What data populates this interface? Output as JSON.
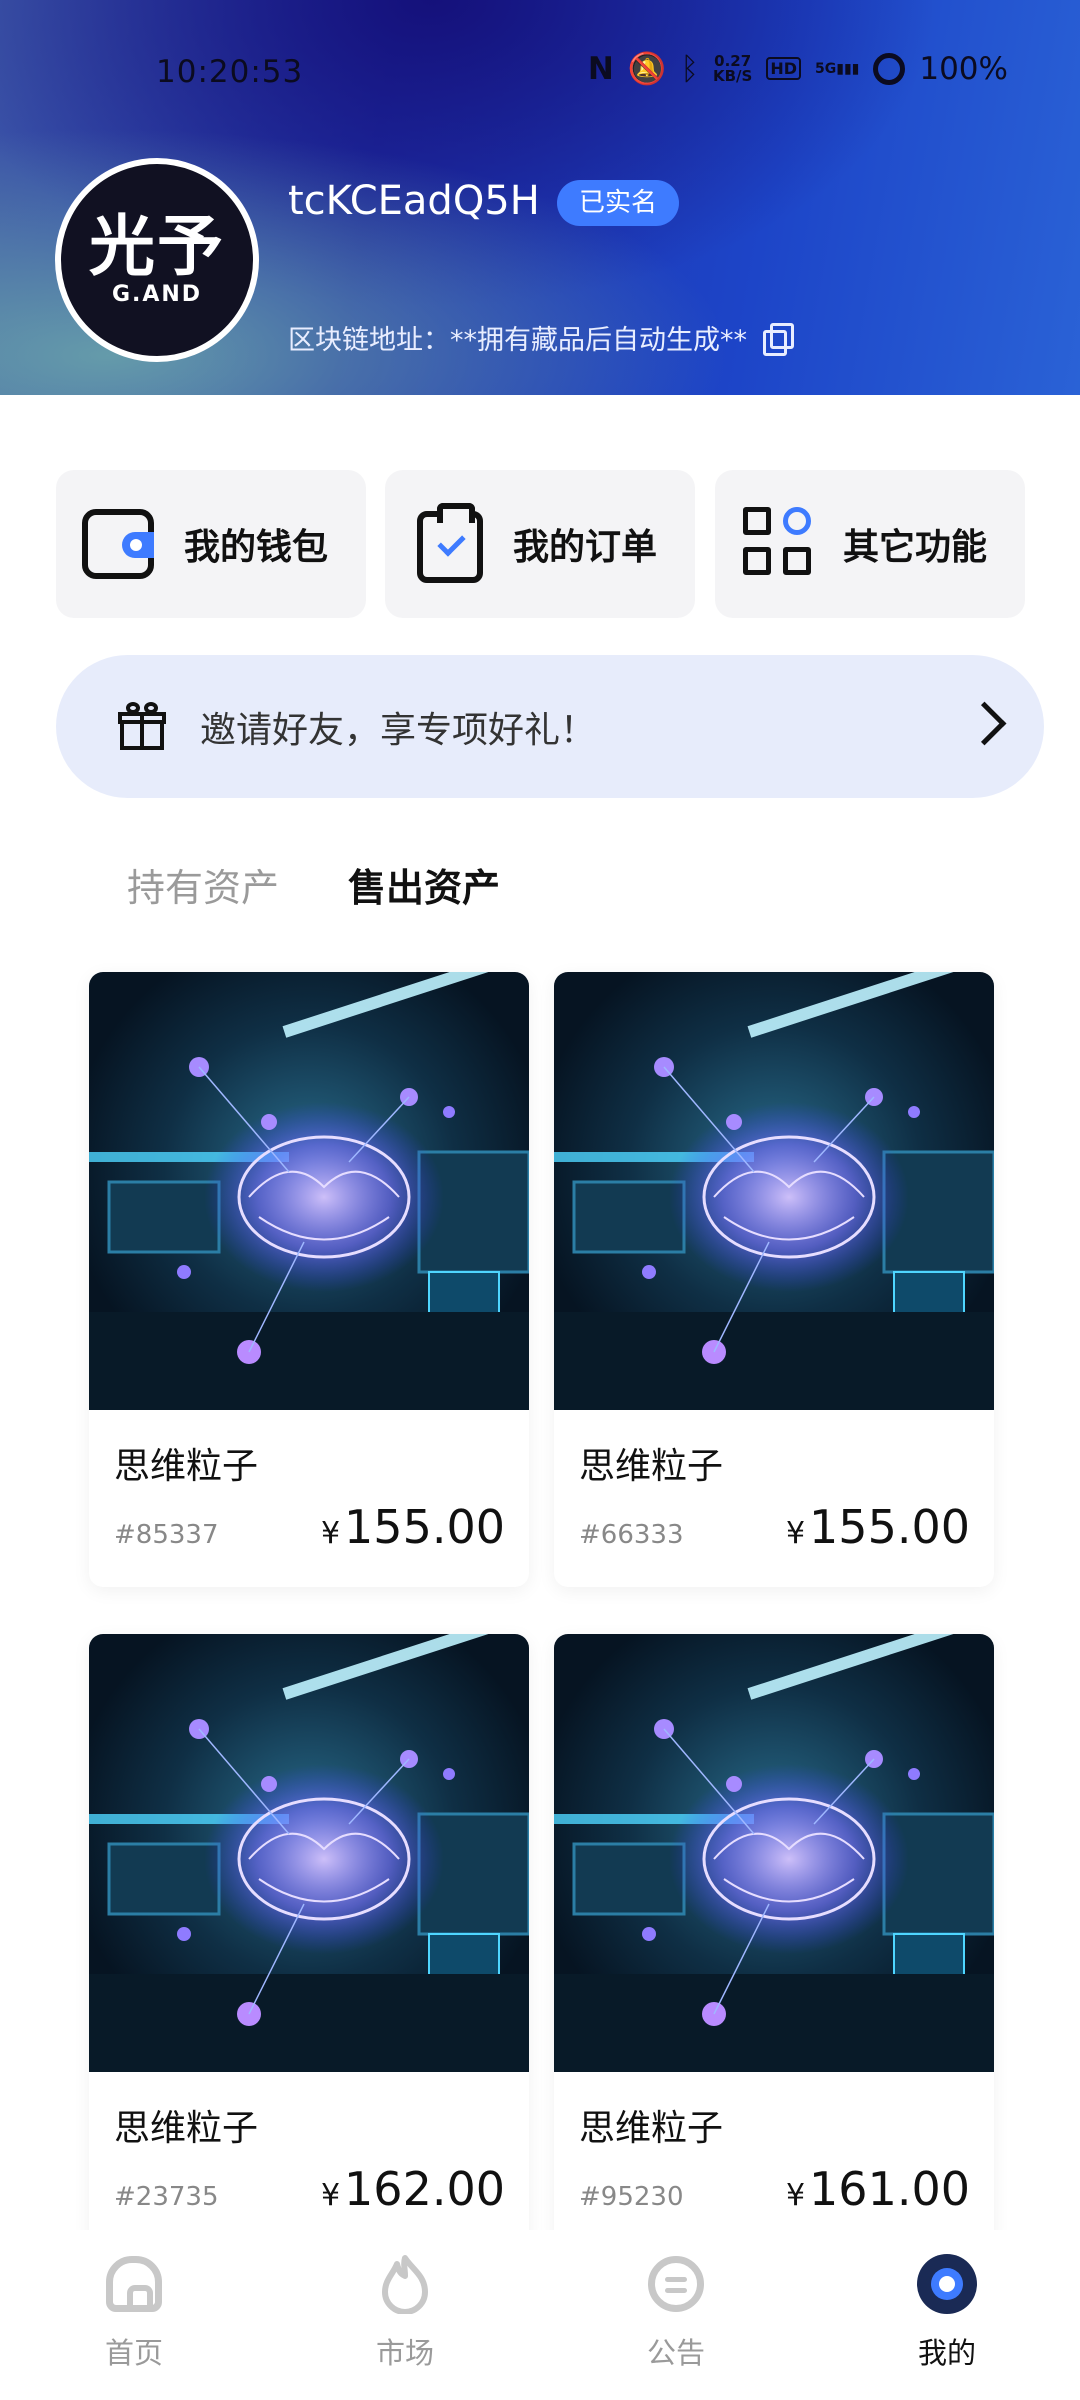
{
  "status_bar": {
    "time": "10:20:53",
    "net_speed_value": "0.27",
    "net_speed_unit": "KB/S",
    "hd_label": "HD",
    "signal_label": "5G",
    "battery": "100%"
  },
  "profile": {
    "avatar_main": "光予",
    "avatar_sub": "G.AND",
    "username": "tcKCEadQ5H",
    "verified_badge": "已实名",
    "chain_address": "区块链地址：**拥有藏品后自动生成**"
  },
  "quick_actions": [
    {
      "label": "我的钱包",
      "icon": "wallet-icon"
    },
    {
      "label": "我的订单",
      "icon": "clipboard-check-icon"
    },
    {
      "label": "其它功能",
      "icon": "grid-apps-icon"
    }
  ],
  "invite_banner": {
    "text": "邀请好友，享专项好礼！",
    "icon": "gift-icon"
  },
  "tabs": [
    {
      "label": "持有资产",
      "active": false
    },
    {
      "label": "售出资产",
      "active": true
    }
  ],
  "assets": [
    {
      "title": "思维粒子",
      "id": "#85337",
      "currency": "¥",
      "price": "155.00"
    },
    {
      "title": "思维粒子",
      "id": "#66333",
      "currency": "¥",
      "price": "155.00"
    },
    {
      "title": "思维粒子",
      "id": "#23735",
      "currency": "¥",
      "price": "162.00"
    },
    {
      "title": "思维粒子",
      "id": "#95230",
      "currency": "¥",
      "price": "161.00"
    }
  ],
  "bottom_nav": [
    {
      "label": "首页",
      "icon": "home-icon",
      "active": false
    },
    {
      "label": "市场",
      "icon": "market-icon",
      "active": false
    },
    {
      "label": "公告",
      "icon": "notice-icon",
      "active": false
    },
    {
      "label": "我的",
      "icon": "profile-icon",
      "active": true
    }
  ],
  "colors": {
    "accent": "#3e7bff",
    "header_dark": "#1f2fa8",
    "banner_bg": "#e7ecfb",
    "inactive_text": "#9a9a9a"
  }
}
